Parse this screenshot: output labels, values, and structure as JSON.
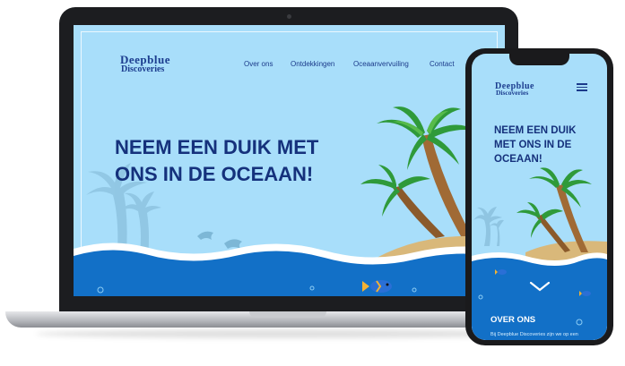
{
  "desktop": {
    "logo": {
      "line1": "Deepblue",
      "line2": "Discoveries"
    },
    "nav": [
      "Over ons",
      "Ontdekkingen",
      "Oceaanvervuiling",
      "Contact"
    ],
    "headline": [
      "NEEM EEN DUIK MET",
      "ONS IN DE OCEAAN!"
    ]
  },
  "mobile": {
    "logo": {
      "line1": "Deepblue",
      "line2": "Discoveries"
    },
    "headline": [
      "NEEM EEN DUIK",
      "MET ONS IN DE",
      "OCEAAN!"
    ],
    "section_title": "OVER ONS",
    "section_text": "Bij Deepblue Discoveries zijn we op een"
  },
  "colors": {
    "sky": "#a8defa",
    "navy": "#15317c",
    "ocean": "#1270c7",
    "sand": "#d9b87a",
    "palm": "#2f9a3a"
  },
  "icons": [
    "menu-icon",
    "chevron-down-icon"
  ]
}
